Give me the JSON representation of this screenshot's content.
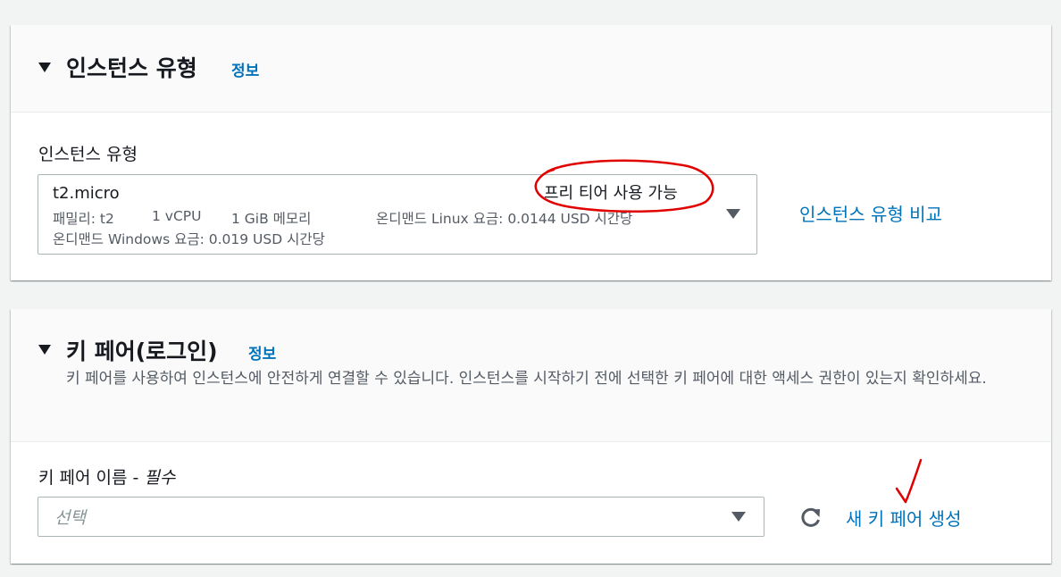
{
  "instance_type_section": {
    "title": "인스턴스 유형",
    "info_link": "정보",
    "field_label": "인스턴스 유형",
    "selected": {
      "name": "t2.micro",
      "family": "패밀리: t2",
      "vcpu": "1 vCPU",
      "memory": "1 GiB 메모리",
      "linux_price": "온디맨드 Linux 요금: 0.0144 USD 시간당",
      "windows_price": "온디맨드 Windows 요금: 0.019 USD 시간당",
      "free_tier": "프리 티어 사용 가능"
    },
    "compare_link": "인스턴스 유형 비교"
  },
  "key_pair_section": {
    "title": "키 페어(로그인)",
    "info_link": "정보",
    "description": "키 페어를 사용하여 인스턴스에 안전하게 연결할 수 있습니다. 인스턴스를 시작하기 전에 선택한 키 페어에 대한 액세스 권한이 있는지 확인하세요.",
    "field_label": "키 페어 이름 - ",
    "required_label": "필수",
    "select_placeholder": "선택",
    "create_link": "새 키 페어 생성"
  },
  "colors": {
    "link": "#0073bb",
    "annotation": "#e00000"
  }
}
